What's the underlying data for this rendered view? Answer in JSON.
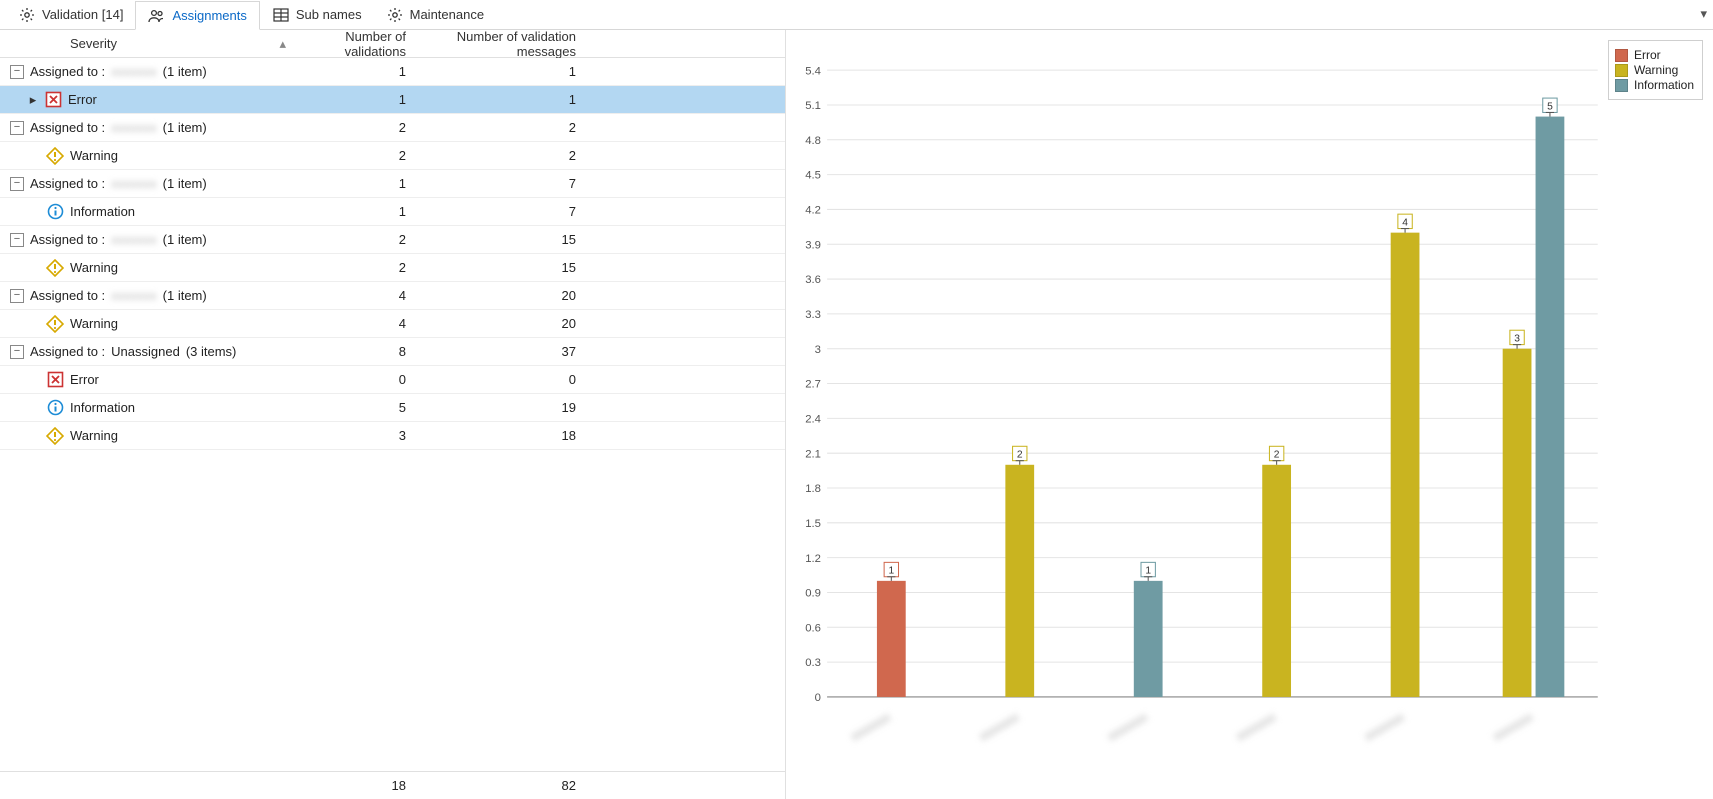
{
  "tabs": [
    {
      "label": "Validation [14]",
      "icon": "gear"
    },
    {
      "label": "Assignments",
      "icon": "people",
      "active": true
    },
    {
      "label": "Sub names",
      "icon": "columns"
    },
    {
      "label": "Maintenance",
      "icon": "gear"
    }
  ],
  "columns": {
    "severity": "Severity",
    "num_validations": "Number of validations",
    "num_messages": "Number of validation messages"
  },
  "groups": [
    {
      "label": "Assigned to :",
      "name": "",
      "items_text": "(1 item)",
      "nv": 1,
      "nm": 1,
      "children": [
        {
          "sev": "Error",
          "nv": 1,
          "nm": 1,
          "selected": true,
          "arrow": true
        }
      ]
    },
    {
      "label": "Assigned to :",
      "name": "",
      "items_text": "(1 item)",
      "nv": 2,
      "nm": 2,
      "children": [
        {
          "sev": "Warning",
          "nv": 2,
          "nm": 2
        }
      ]
    },
    {
      "label": "Assigned to :",
      "name": "",
      "items_text": "(1 item)",
      "nv": 1,
      "nm": 7,
      "children": [
        {
          "sev": "Information",
          "nv": 1,
          "nm": 7
        }
      ]
    },
    {
      "label": "Assigned to :",
      "name": "",
      "items_text": "(1 item)",
      "nv": 2,
      "nm": 15,
      "children": [
        {
          "sev": "Warning",
          "nv": 2,
          "nm": 15
        }
      ]
    },
    {
      "label": "Assigned to :",
      "name": "",
      "items_text": "(1 item)",
      "nv": 4,
      "nm": 20,
      "children": [
        {
          "sev": "Warning",
          "nv": 4,
          "nm": 20
        }
      ]
    },
    {
      "label": "Assigned to :",
      "name": "Unassigned",
      "items_text": "(3 items)",
      "nv": 8,
      "nm": 37,
      "children": [
        {
          "sev": "Error",
          "nv": 0,
          "nm": 0
        },
        {
          "sev": "Information",
          "nv": 5,
          "nm": 19
        },
        {
          "sev": "Warning",
          "nv": 3,
          "nm": 18
        }
      ]
    }
  ],
  "footer": {
    "nv": 18,
    "nm": 82
  },
  "legend": [
    {
      "label": "Error",
      "color": "#d0684e"
    },
    {
      "label": "Warning",
      "color": "#c9b420"
    },
    {
      "label": "Information",
      "color": "#6f9ba3"
    }
  ],
  "chart_data": {
    "type": "bar",
    "ylabel": "",
    "ylim": [
      0,
      5.4
    ],
    "yticks": [
      0,
      0.3,
      0.6,
      0.9,
      1.2,
      1.5,
      1.8,
      2.1,
      2.4,
      2.7,
      3,
      3.3,
      3.6,
      3.9,
      4.2,
      4.5,
      4.8,
      5.1,
      5.4
    ],
    "categories": [
      "",
      "",
      "",
      "",
      "",
      ""
    ],
    "series": [
      {
        "name": "Error",
        "color": "#d0684e",
        "values": [
          1,
          null,
          null,
          null,
          null,
          null
        ]
      },
      {
        "name": "Warning",
        "color": "#c9b420",
        "values": [
          null,
          2,
          null,
          2,
          4,
          3
        ]
      },
      {
        "name": "Information",
        "color": "#6f9ba3",
        "values": [
          null,
          null,
          1,
          null,
          null,
          5
        ]
      }
    ]
  }
}
